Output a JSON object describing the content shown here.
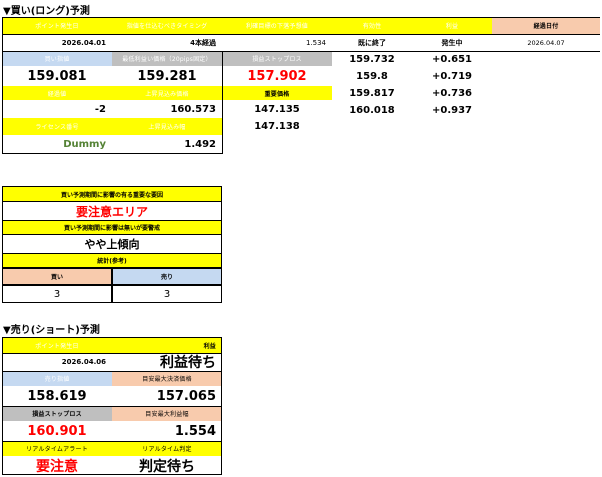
{
  "long": {
    "title": "▼買い(ロング)予測",
    "headers": [
      "ポイント発生日",
      "指値を仕込むべきタイミング",
      "利確目標の下落予想値",
      "有効性",
      "利益",
      "経過日付"
    ],
    "row1": {
      "date": "2026.04.01",
      "timing": "4本経過",
      "forecast": "1.534",
      "validity": "既に終了",
      "profit": "発生中",
      "elapsed_date": "2026.04.07"
    },
    "row2_headers": [
      "買い指値",
      "最低利益い価格（20pips固定）",
      "損益ストップロス"
    ],
    "row2": {
      "buy_limit": "159.081",
      "min_profit": "159.281",
      "stop_loss": "157.902"
    },
    "row3_headers": [
      "経過値",
      "上昇見込み価格",
      "重要価格"
    ],
    "row3": {
      "elapsed": "-2",
      "rise_price": "160.573",
      "important_a": "147.135",
      "important_b": "147.138"
    },
    "row4_headers": [
      "ライセンス番号",
      "上昇見込み幅"
    ],
    "row4": {
      "license": "Dummy",
      "rise_width": "1.492"
    },
    "side_values": [
      "159.732",
      "159.8",
      "159.817",
      "160.018"
    ],
    "side_profits": [
      "+0.651",
      "+0.719",
      "+0.736",
      "+0.937"
    ]
  },
  "mid": {
    "title1": "買い予測期間に影響の有る重要な要因",
    "value1": "要注意エリア",
    "title2": "買い予測期間に影響は無いが要警戒",
    "value2": "やや上傾向",
    "title3": "統計(参考)",
    "buy_label": "買い",
    "sell_label": "売り",
    "buy_count": "3",
    "sell_count": "3"
  },
  "short": {
    "title": "▼売り(ショート)予測",
    "h1": [
      "ポイント発生日",
      "利益"
    ],
    "r1": {
      "date": "2026.04.06",
      "profit": "利益待ち"
    },
    "h2": [
      "売り指値",
      "目安最大決済価格"
    ],
    "r2": {
      "sell_limit": "158.619",
      "max_price": "157.065"
    },
    "h3": [
      "損益ストップロス",
      "目安最大利益幅"
    ],
    "r3": {
      "stop_loss": "160.901",
      "max_width": "1.554"
    },
    "h4": [
      "リアルタイムアラート",
      "リアルタイム判定"
    ],
    "r4": {
      "alert": "要注意",
      "judge": "判定待ち"
    }
  }
}
